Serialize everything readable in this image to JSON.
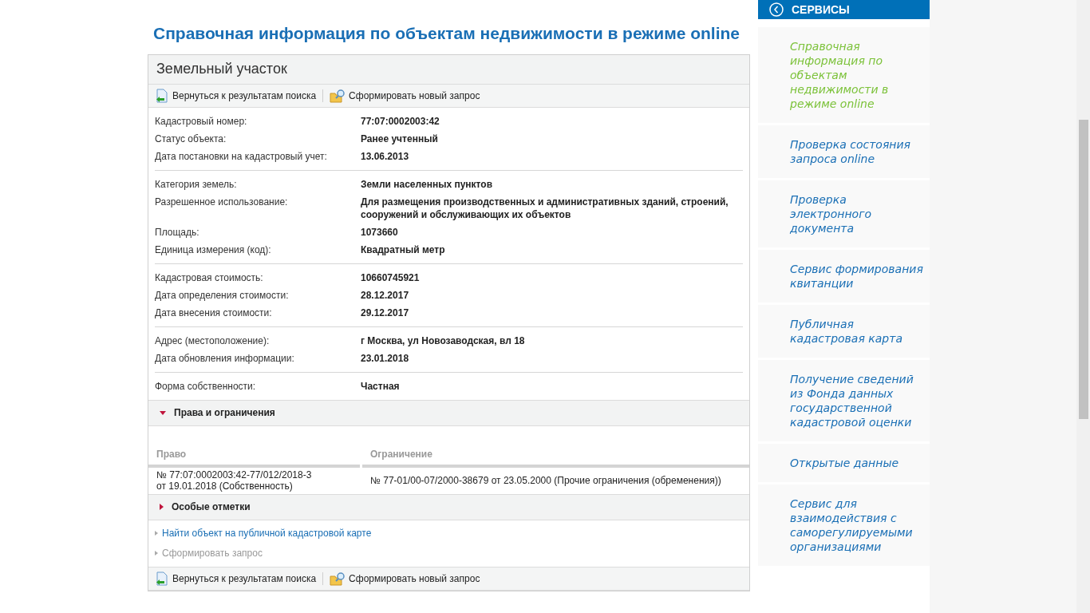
{
  "page_title": "Справочная информация по объектам недвижимости в режиме online",
  "panel": {
    "title": "Земельный участок",
    "toolbar": [
      {
        "kind": "back",
        "label": "Вернуться к результатам поиска"
      },
      {
        "kind": "new",
        "label": "Сформировать новый запрос"
      }
    ],
    "groups": [
      [
        {
          "label": "Кадастровый номер:",
          "value": "77:07:0002003:42"
        },
        {
          "label": "Статус объекта:",
          "value": "Ранее учтенный"
        },
        {
          "label": "Дата постановки на кадастровый учет:",
          "value": "13.06.2013"
        }
      ],
      [
        {
          "label": "Категория земель:",
          "value": "Земли населенных пунктов"
        },
        {
          "label": "Разрешенное использование:",
          "value": "Для размещения производственных и административных зданий, строений, сооружений и обслуживающих их объектов"
        },
        {
          "label": "Площадь:",
          "value": "1073660"
        },
        {
          "label": "Единица измерения (код):",
          "value": "Квадратный метр"
        }
      ],
      [
        {
          "label": "Кадастровая стоимость:",
          "value": "10660745921"
        },
        {
          "label": "Дата определения стоимости:",
          "value": "28.12.2017"
        },
        {
          "label": "Дата внесения стоимости:",
          "value": "29.12.2017"
        }
      ],
      [
        {
          "label": "Адрес (местоположение):",
          "value": "г Москва, ул Новозаводская, вл 18"
        },
        {
          "label": "Дата обновления информации:",
          "value": "23.01.2018"
        }
      ],
      [
        {
          "label": "Форма собственности:",
          "value": "Частная"
        }
      ]
    ],
    "rights": {
      "title": "Права и ограничения",
      "expanded": true,
      "columns": [
        "Право",
        "Ограничение"
      ],
      "rows": [
        [
          "№ 77:07:0002003:42-77/012/2018-3\n от 19.01.2018  (Собственность)",
          "№ 77-01/00-07/2000-38679  от 23.05.2000  (Прочие ограничения (обременения))"
        ]
      ]
    },
    "notes": {
      "title": "Особые отметки",
      "expanded": false
    },
    "links": [
      {
        "label": "Найти объект на публичной кадастровой карте",
        "disabled": false
      },
      {
        "label": "Сформировать запрос",
        "disabled": true
      }
    ],
    "bottom_toolbar": [
      {
        "kind": "back",
        "label": "Вернуться к результатам поиска"
      },
      {
        "kind": "new",
        "label": "Сформировать новый запрос"
      }
    ]
  },
  "sidebar": {
    "title": "СЕРВИСЫ",
    "items": [
      {
        "label": "Справочная информация по объектам недвижимости в режиме online",
        "selected": true
      },
      {
        "label": "Проверка состояния запроса online",
        "selected": false
      },
      {
        "label": "Проверка электронного документа",
        "selected": false
      },
      {
        "label": "Сервис формирования квитанции",
        "selected": false
      },
      {
        "label": "Публичная кадастровая карта",
        "selected": false
      },
      {
        "label": "Получение сведений из Фонда данных государственной кадастровой оценки",
        "selected": false
      },
      {
        "label": "Открытые данные",
        "selected": false
      },
      {
        "label": "Сервис для взаимодействия с саморегулируемыми организациями",
        "selected": false
      }
    ]
  }
}
